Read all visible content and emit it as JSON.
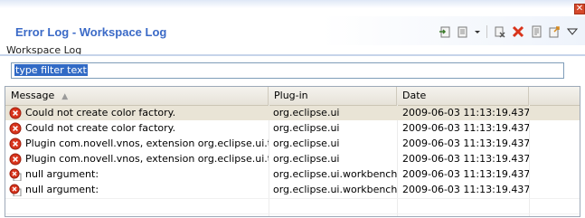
{
  "window": {
    "title": "Error Log - Workspace Log",
    "close_glyph": "✕"
  },
  "toolbar": {
    "icons": [
      "export-log-icon",
      "import-log-icon",
      "dropdown-arrow-icon",
      "clear-log-icon",
      "delete-log-icon",
      "open-log-icon",
      "restore-log-icon",
      "view-menu-icon"
    ]
  },
  "subtitle": "Workspace Log",
  "filter": {
    "value": "type filter text"
  },
  "table": {
    "columns": [
      {
        "label": "Message",
        "sort_indicator": "▲"
      },
      {
        "label": "Plug-in"
      },
      {
        "label": "Date"
      }
    ],
    "rows": [
      {
        "icon": "error-icon",
        "message": "Could not create color factory.",
        "plugin": "org.eclipse.ui",
        "date": "2009-06-03 11:13:19.437",
        "selected": true
      },
      {
        "icon": "error-icon",
        "message": "Could not create color factory.",
        "plugin": "org.eclipse.ui",
        "date": "2009-06-03 11:13:19.437",
        "selected": false
      },
      {
        "icon": "error-icon",
        "message": "Plugin com.novell.vnos, extension org.eclipse.ui.them",
        "plugin": "org.eclipse.ui",
        "date": "2009-06-03 11:13:19.437",
        "selected": false
      },
      {
        "icon": "error-icon",
        "message": "Plugin com.novell.vnos, extension org.eclipse.ui.them",
        "plugin": "org.eclipse.ui",
        "date": "2009-06-03 11:13:19.437",
        "selected": false
      },
      {
        "icon": "error-stack-icon",
        "message": "null argument:",
        "plugin": "org.eclipse.ui.workbench",
        "date": "2009-06-03 11:13:19.437",
        "selected": false
      },
      {
        "icon": "error-stack-icon",
        "message": "null argument:",
        "plugin": "org.eclipse.ui.workbench",
        "date": "2009-06-03 11:13:19.437",
        "selected": false
      }
    ]
  },
  "colors": {
    "title": "#3b6ac7",
    "error": "#d9341c",
    "selection": "#e9e4d6",
    "filter_highlight": "#316ac5"
  }
}
